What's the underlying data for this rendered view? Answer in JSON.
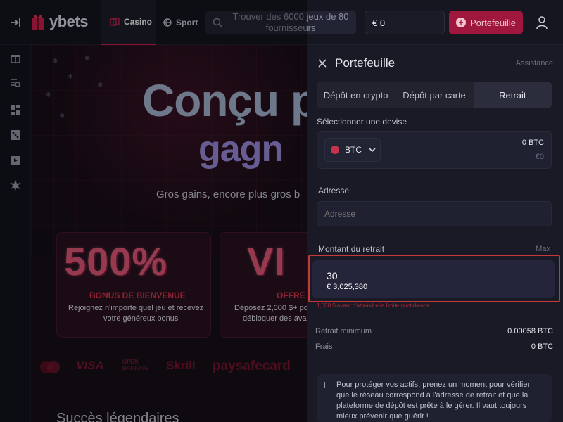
{
  "header": {
    "logo": "ybets",
    "nav": [
      {
        "label": "Casino"
      },
      {
        "label": "Sport"
      }
    ],
    "search_placeholder": "Trouver des 6000 jeux de 80 fournisseurs",
    "balance": "€ 0",
    "wallet_button": "Portefeuille"
  },
  "sidebar": {
    "icons": [
      "gift-icon",
      "search-list-icon",
      "dashboard-icon",
      "dice-icon",
      "play-icon",
      "star-burst-icon"
    ]
  },
  "hero": {
    "title_line1": "Conçu p",
    "title_line2": "gagn",
    "subtitle": "Gros gains, encore plus gros b",
    "promos": [
      {
        "big": "500%",
        "label": "BONUS DE BIENVENUE",
        "desc_line1": "Rejoignez n'importe quel jeu et recevez",
        "desc_line2": "votre généreux bonus"
      },
      {
        "big": "VI",
        "label": "OFFRE",
        "desc_line1": "Déposez 2,000 $+ po",
        "desc_line2": "débloquer des avan"
      }
    ],
    "payments": [
      "VISA",
      "OPEN BANKING",
      "Skrill",
      "paysafecard"
    ],
    "section_title": "Succès légendaires"
  },
  "wallet": {
    "title": "Portefeuille",
    "assistance": "Assistance",
    "tabs": [
      "Dépôt en crypto",
      "Dépôt par carte",
      "Retrait"
    ],
    "active_tab": "Retrait",
    "currency_label": "Sélectionner une devise",
    "currency": "BTC",
    "currency_balance": "0 BTC",
    "currency_balance_eur": "€0",
    "address_label": "Adresse",
    "address_placeholder": "Adresse",
    "amount_label": "Montant du retrait",
    "max_label": "Max",
    "amount_value": "30",
    "amount_eur": "€ 3,025,380",
    "limit_note": "1,000 $ avant d'atteindre la limite quotidienne",
    "min_withdraw_label": "Retrait minimum",
    "min_withdraw_value": "0.00058 BTC",
    "fees_label": "Frais",
    "fees_value": "0 BTC",
    "info_text": "Pour protéger vos actifs, prenez un moment pour vérifier que le réseau correspond à l'adresse de retrait et que la plateforme de dépôt est prête à le gérer. Il vaut toujours mieux prévenir que guérir !"
  },
  "colors": {
    "accent": "#d31e4d",
    "wallet_button_bg": "#a0173d",
    "highlight_border": "#c43a3a"
  }
}
